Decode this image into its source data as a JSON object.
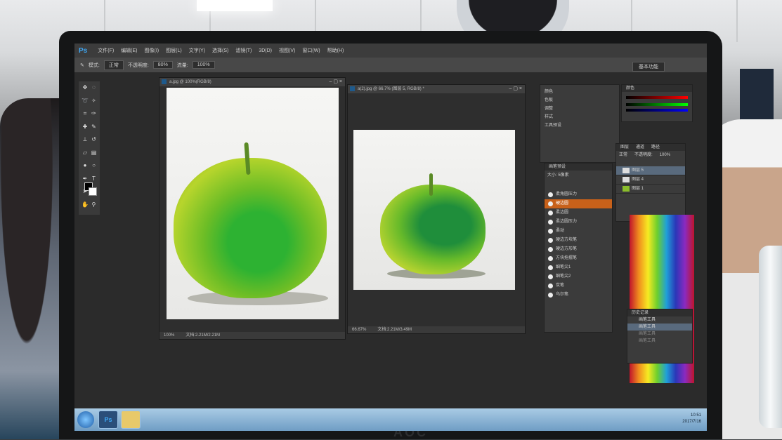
{
  "app": {
    "logo": "Ps"
  },
  "menu": [
    "文件(F)",
    "编辑(E)",
    "图像(I)",
    "图层(L)",
    "文字(Y)",
    "选择(S)",
    "滤镜(T)",
    "3D(D)",
    "视图(V)",
    "窗口(W)",
    "帮助(H)"
  ],
  "options_bar": {
    "mode_label": "模式:",
    "mode_value": "正常",
    "opacity_label": "不透明度:",
    "opacity_value": "80%",
    "flow_label": "流量:",
    "flow_value": "100%",
    "workspace": "基本功能"
  },
  "documents": [
    {
      "tab": "a.jpg @ 100%(RGB/8)",
      "zoom": "100%",
      "status": "文档:2.21M/2.21M"
    },
    {
      "tab": "a(2).jpg @ 66.7% (图层 5, RGB/8) *",
      "zoom": "66.67%",
      "status": "文档:2.21M/3.49M"
    }
  ],
  "brush_panel": {
    "title": "画笔预设",
    "size_label": "大小:",
    "size_value": "5像素",
    "items": [
      "柔角圆压力",
      "硬边圆",
      "柔边圆",
      "柔边圆压力",
      "柔动",
      "硬边方块笔",
      "硬边方形笔",
      "方块拖摆笔",
      "细笔尖1",
      "细笔尖2",
      "炭笔",
      "乌尔笔"
    ],
    "selected_index": 1
  },
  "adjust_panel": {
    "items": [
      "颜色",
      "色板",
      "调整",
      "样式",
      "工具预设"
    ]
  },
  "color_panel": {
    "title": "颜色"
  },
  "layers_panel": {
    "tabs": [
      "图层",
      "通道",
      "路径"
    ],
    "blend": "正常",
    "opacity_label": "不透明度:",
    "opacity_value": "100%",
    "layers": [
      "图层 5",
      "图层 4",
      "图层 1"
    ],
    "selected_index": 0
  },
  "history_panel": {
    "title": "历史记录",
    "items": [
      "画笔工具",
      "画笔工具",
      "画笔工具",
      "画笔工具"
    ]
  },
  "taskbar": {
    "ps_label": "Ps",
    "clock": "10:51",
    "date": "2017/7/16"
  },
  "monitor_brand": "AOC"
}
